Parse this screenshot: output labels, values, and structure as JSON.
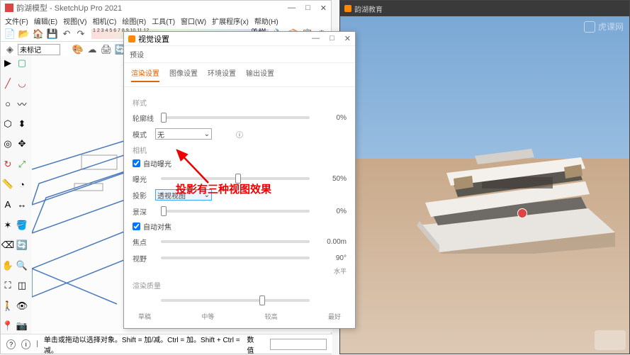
{
  "sketchup": {
    "title": "韵湖模型 - SketchUp Pro 2021",
    "menubar": [
      "文件(F)",
      "编辑(E)",
      "视图(V)",
      "相机(C)",
      "绘图(R)",
      "工具(T)",
      "窗口(W)",
      "扩展程序(x)",
      "帮助(H)"
    ],
    "layer": "未标记",
    "timeline_label": "06 AM",
    "timeline_ticks": "1 2 3 4 5 6 7 8 9 10 11 12"
  },
  "statusbar": {
    "hint": "单击或拖动以选择对象。Shift = 加/减。Ctrl = 加。Shift + Ctrl = 减。",
    "num_label": "数值"
  },
  "dialog": {
    "title": "视觉设置",
    "preset": "预设",
    "tabs": [
      "渲染设置",
      "图像设置",
      "环境设置",
      "输出设置"
    ],
    "section_style": "样式",
    "row_lunkuo": {
      "label": "轮廓线",
      "value": "0%"
    },
    "row_mode": {
      "label": "模式",
      "value": "无"
    },
    "section_camera": "相机",
    "auto_exposure": "自动曝光",
    "row_exposure": {
      "label": "曝光",
      "value": "50%"
    },
    "row_projection": {
      "label": "投影",
      "value": "透视视图"
    },
    "row_depth": {
      "label": "景深",
      "value": "0%"
    },
    "auto_focus": "自动对焦",
    "row_focus": {
      "label": "焦点",
      "value": "0.00m"
    },
    "row_fov": {
      "label": "视野",
      "value": "90°",
      "sub": "水平"
    },
    "section_quality": "渲染质量",
    "quality_labels": [
      "草稿",
      "中等",
      "较高",
      "最好"
    ]
  },
  "annotation": "投影有三种视图效果",
  "render": {
    "title": "韵湖教育",
    "watermark": "虎课网"
  }
}
